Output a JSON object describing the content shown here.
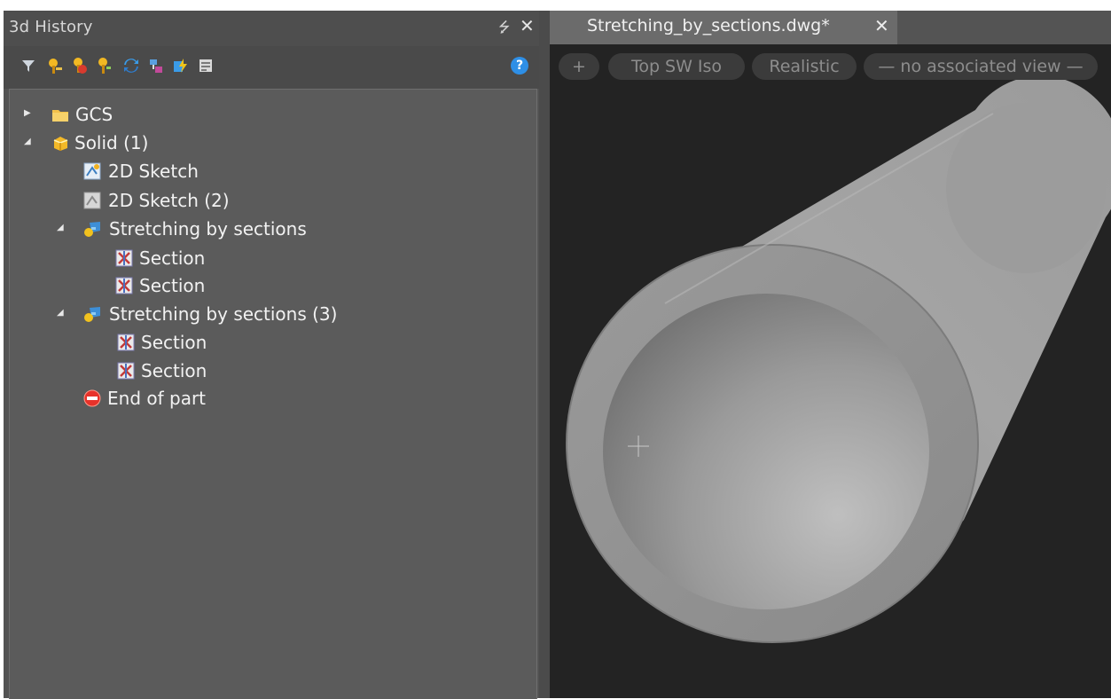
{
  "history_panel": {
    "title": "3d History",
    "pin_glyph": "⭍",
    "close_glyph": "✕",
    "help_glyph": "?",
    "toolbar_icons": [
      "filter-icon",
      "pin-yellow-icon",
      "pin-red-icon",
      "pin-green-icon",
      "refresh-icon",
      "node-icon",
      "lightning-icon",
      "properties-icon"
    ],
    "tree": [
      {
        "label": "GCS",
        "expander": "▶",
        "icon": "folder-icon"
      },
      {
        "label": "Solid (1)",
        "expander": "◢",
        "icon": "solid-icon"
      },
      {
        "label": "2D Sketch",
        "expander": "",
        "icon": "sketch-icon"
      },
      {
        "label": "2D Sketch (2)",
        "expander": "",
        "icon": "sketch-gray-icon"
      },
      {
        "label": "Stretching by sections",
        "expander": "◢",
        "icon": "stretch-icon"
      },
      {
        "label": "Section",
        "expander": "",
        "icon": "section-icon"
      },
      {
        "label": "Section",
        "expander": "",
        "icon": "section-icon"
      },
      {
        "label": "Stretching by sections (3)",
        "expander": "◢",
        "icon": "stretch-icon"
      },
      {
        "label": "Section",
        "expander": "",
        "icon": "section-icon"
      },
      {
        "label": "Section",
        "expander": "",
        "icon": "section-icon"
      },
      {
        "label": "End of part",
        "expander": "",
        "icon": "end-icon"
      }
    ]
  },
  "viewport": {
    "tab_title": "Stretching_by_sections.dwg*",
    "tab_close": "✕",
    "controls": {
      "plus": "+",
      "view": "Top SW Iso",
      "style": "Realistic",
      "assoc": "— no associated view —"
    }
  },
  "colors": {
    "panel_bg": "#535353",
    "tree_bg": "#5b5b5b",
    "viewport_bg": "#232323",
    "accent_blue": "#2e8fe6"
  }
}
